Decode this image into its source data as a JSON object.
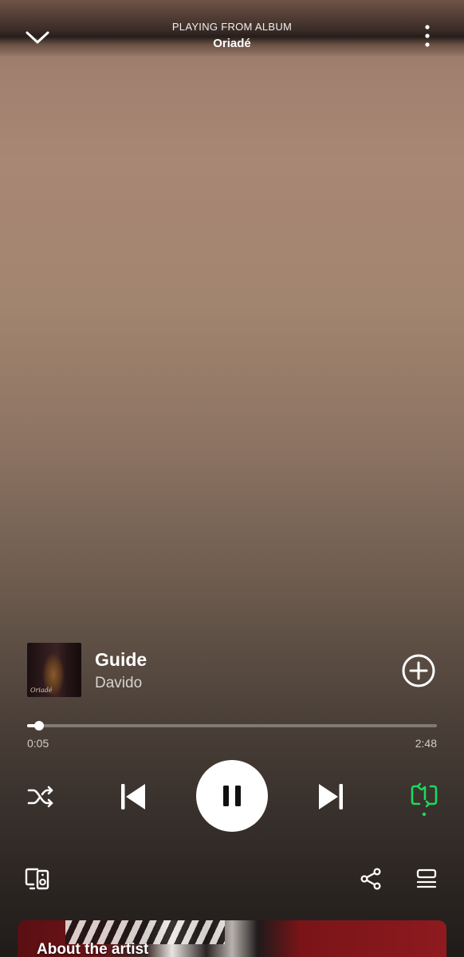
{
  "header": {
    "context_label": "PLAYING FROM ALBUM",
    "context_name": "Oriadé",
    "collapse_icon": "chevron-down-icon",
    "more_icon": "more-vertical-icon"
  },
  "track": {
    "title": "Guide",
    "artist": "Davido",
    "cover_signature": "Oriadé",
    "add_icon": "plus-circle-icon"
  },
  "playback": {
    "elapsed": "0:05",
    "duration": "2:48",
    "progress_fraction": 0.03,
    "state": "playing",
    "repeat_mode": "repeat-one",
    "repeat_color": "#1ed760",
    "shuffle": false
  },
  "controls": {
    "shuffle_icon": "shuffle-icon",
    "previous_icon": "skip-previous-icon",
    "pause_icon": "pause-icon",
    "next_icon": "skip-next-icon",
    "repeat_icon": "repeat-one-icon"
  },
  "bottom_bar": {
    "devices_icon": "connect-devices-icon",
    "share_icon": "share-icon",
    "queue_icon": "queue-icon"
  },
  "artist_card": {
    "label": "About the artist"
  }
}
